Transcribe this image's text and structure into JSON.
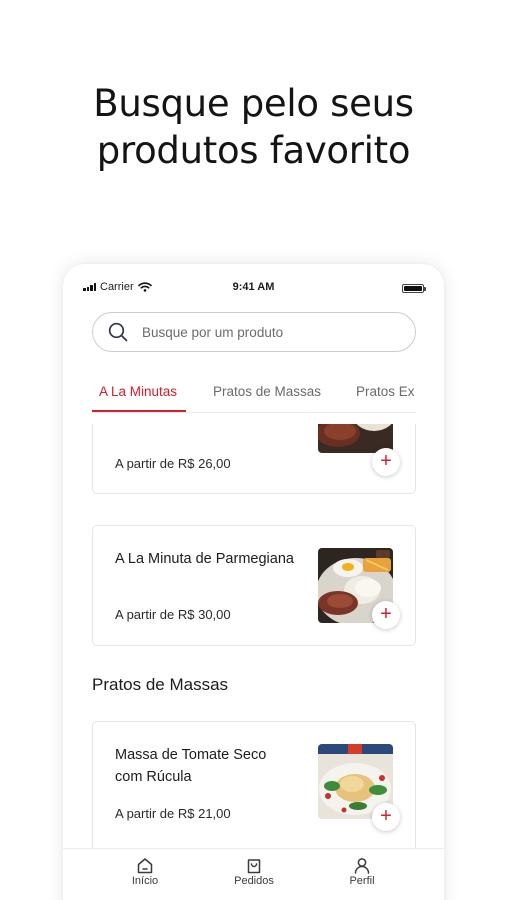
{
  "headline": {
    "line1": "Busque pelo seus",
    "line2": "produtos favorito"
  },
  "status_bar": {
    "carrier": "Carrier",
    "time": "9:41 AM"
  },
  "search": {
    "placeholder": "Busque por um produto"
  },
  "tabs": [
    {
      "label": "A La Minutas",
      "active": true
    },
    {
      "label": "Pratos de Massas",
      "active": false
    },
    {
      "label": "Pratos Ex",
      "active": false
    }
  ],
  "products": [
    {
      "name": "",
      "price": "A partir de R$ 26,00"
    },
    {
      "name": "A La Minuta de Parmegiana",
      "price": "A partir de R$ 30,00"
    },
    {
      "name": "Massa de Tomate Seco com Rúcula",
      "price": "A partir de R$ 21,00"
    }
  ],
  "sections": {
    "massas": "Pratos de Massas"
  },
  "add_button": {
    "symbol": "+"
  },
  "bottom_nav": [
    {
      "label": "Início",
      "icon": "home-icon"
    },
    {
      "label": "Pedidos",
      "icon": "bag-icon"
    },
    {
      "label": "Perfil",
      "icon": "user-icon"
    }
  ],
  "colors": {
    "accent": "#d3202a",
    "text": "#1c1c1e",
    "muted": "#6a6a6f"
  }
}
